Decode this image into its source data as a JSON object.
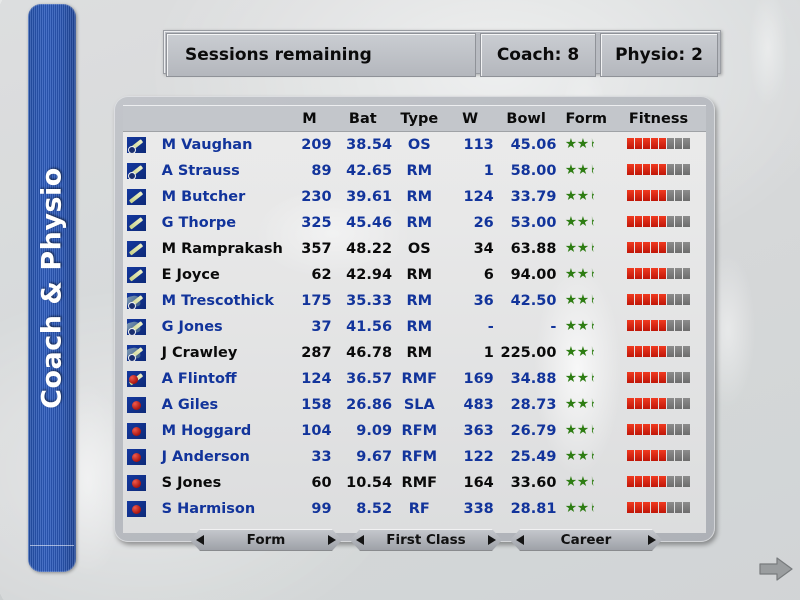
{
  "sidebar": {
    "title": "Coach & Physio"
  },
  "topbar": {
    "sessions_label": "Sessions remaining",
    "coach_label": "Coach: 8",
    "physio_label": "Physio: 2"
  },
  "table": {
    "headers": [
      "",
      "",
      "M",
      "Bat",
      "Type",
      "W",
      "Bowl",
      "Form",
      "Fitness"
    ],
    "rows": [
      {
        "icon": "bat-helmet-icon",
        "name": "M Vaughan",
        "m": "209",
        "bat": "38.54",
        "type": "OS",
        "w": "113",
        "bowl": "45.06",
        "form_full": 2,
        "form_half": 1,
        "fitness_on": 5,
        "fitness_off": 3,
        "color": "blue"
      },
      {
        "icon": "bat-helmet-icon",
        "name": "A Strauss",
        "m": "89",
        "bat": "42.65",
        "type": "RM",
        "w": "1",
        "bowl": "58.00",
        "form_full": 2,
        "form_half": 1,
        "fitness_on": 5,
        "fitness_off": 3,
        "color": "blue"
      },
      {
        "icon": "bat-icon",
        "name": "M Butcher",
        "m": "230",
        "bat": "39.61",
        "type": "RM",
        "w": "124",
        "bowl": "33.79",
        "form_full": 2,
        "form_half": 1,
        "fitness_on": 5,
        "fitness_off": 3,
        "color": "blue"
      },
      {
        "icon": "bat-icon",
        "name": "G Thorpe",
        "m": "325",
        "bat": "45.46",
        "type": "RM",
        "w": "26",
        "bowl": "53.00",
        "form_full": 2,
        "form_half": 1,
        "fitness_on": 5,
        "fitness_off": 3,
        "color": "blue"
      },
      {
        "icon": "bat-icon",
        "name": "M Ramprakash",
        "m": "357",
        "bat": "48.22",
        "type": "OS",
        "w": "34",
        "bowl": "63.88",
        "form_full": 2,
        "form_half": 1,
        "fitness_on": 5,
        "fitness_off": 3,
        "color": "black"
      },
      {
        "icon": "bat-icon",
        "name": "E Joyce",
        "m": "62",
        "bat": "42.94",
        "type": "RM",
        "w": "6",
        "bowl": "94.00",
        "form_full": 2,
        "form_half": 1,
        "fitness_on": 5,
        "fitness_off": 3,
        "color": "black"
      },
      {
        "icon": "keeper-glove-icon",
        "name": "M Trescothick",
        "m": "175",
        "bat": "35.33",
        "type": "RM",
        "w": "36",
        "bowl": "42.50",
        "form_full": 2,
        "form_half": 1,
        "fitness_on": 5,
        "fitness_off": 3,
        "color": "blue"
      },
      {
        "icon": "keeper-glove-icon",
        "name": "G Jones",
        "m": "37",
        "bat": "41.56",
        "type": "RM",
        "w": "-",
        "bowl": "-",
        "form_full": 2,
        "form_half": 1,
        "fitness_on": 5,
        "fitness_off": 3,
        "color": "blue"
      },
      {
        "icon": "keeper-glove-icon",
        "name": "J Crawley",
        "m": "287",
        "bat": "46.78",
        "type": "RM",
        "w": "1",
        "bowl": "225.00",
        "form_full": 2,
        "form_half": 1,
        "fitness_on": 5,
        "fitness_off": 3,
        "color": "black"
      },
      {
        "icon": "allrounder-icon",
        "name": "A Flintoff",
        "m": "124",
        "bat": "36.57",
        "type": "RMF",
        "w": "169",
        "bowl": "34.88",
        "form_full": 2,
        "form_half": 1,
        "fitness_on": 5,
        "fitness_off": 3,
        "color": "blue"
      },
      {
        "icon": "ball-icon",
        "name": "A Giles",
        "m": "158",
        "bat": "26.86",
        "type": "SLA",
        "w": "483",
        "bowl": "28.73",
        "form_full": 2,
        "form_half": 1,
        "fitness_on": 5,
        "fitness_off": 3,
        "color": "blue"
      },
      {
        "icon": "ball-icon",
        "name": "M Hoggard",
        "m": "104",
        "bat": "9.09",
        "type": "RFM",
        "w": "363",
        "bowl": "26.79",
        "form_full": 2,
        "form_half": 1,
        "fitness_on": 5,
        "fitness_off": 3,
        "color": "blue"
      },
      {
        "icon": "ball-icon",
        "name": "J Anderson",
        "m": "33",
        "bat": "9.67",
        "type": "RFM",
        "w": "122",
        "bowl": "25.49",
        "form_full": 2,
        "form_half": 1,
        "fitness_on": 5,
        "fitness_off": 3,
        "color": "blue"
      },
      {
        "icon": "ball-icon",
        "name": "S Jones",
        "m": "60",
        "bat": "10.54",
        "type": "RMF",
        "w": "164",
        "bowl": "33.60",
        "form_full": 2,
        "form_half": 1,
        "fitness_on": 5,
        "fitness_off": 3,
        "color": "black"
      },
      {
        "icon": "ball-icon",
        "name": "S Harmison",
        "m": "99",
        "bat": "8.52",
        "type": "RF",
        "w": "338",
        "bowl": "28.81",
        "form_full": 2,
        "form_half": 1,
        "fitness_on": 5,
        "fitness_off": 3,
        "color": "blue"
      }
    ]
  },
  "nav": {
    "form_label": "Form",
    "first_class_label": "First Class",
    "career_label": "Career"
  },
  "colors": {
    "sidebar_blue": "#2d5cbe",
    "name_blue": "#12349b",
    "form_green": "#2e7d13",
    "fitness_red": "#d8200c",
    "fitness_gray": "#7d7d7d"
  }
}
